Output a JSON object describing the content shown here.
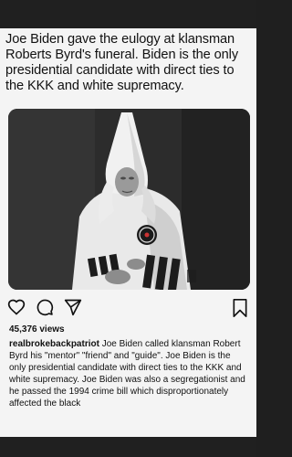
{
  "post": {
    "caption": "Joe Biden gave the eulogy at klansman Roberts Byrd's funeral. Biden is the only presidential candidate with direct ties to the KKK and white supremacy.",
    "views": "45,376 views",
    "username": "realbrokebackpatriot",
    "description": "Joe Biden called klansman Robert Byrd his \"mentor\" \"friend\" and \"guide\". Joe Biden is the only presidential candidate with direct ties to the KKK and white supremacy. Joe Biden was also a segregationist and he passed the 1994 crime bill which disproportionately affected the black"
  },
  "icons": {
    "like": "heart-icon",
    "comment": "comment-icon",
    "share": "share-icon",
    "save": "bookmark-icon"
  },
  "colors": {
    "background": "#f4f4f4",
    "text": "#111111",
    "frame": "#202020"
  }
}
